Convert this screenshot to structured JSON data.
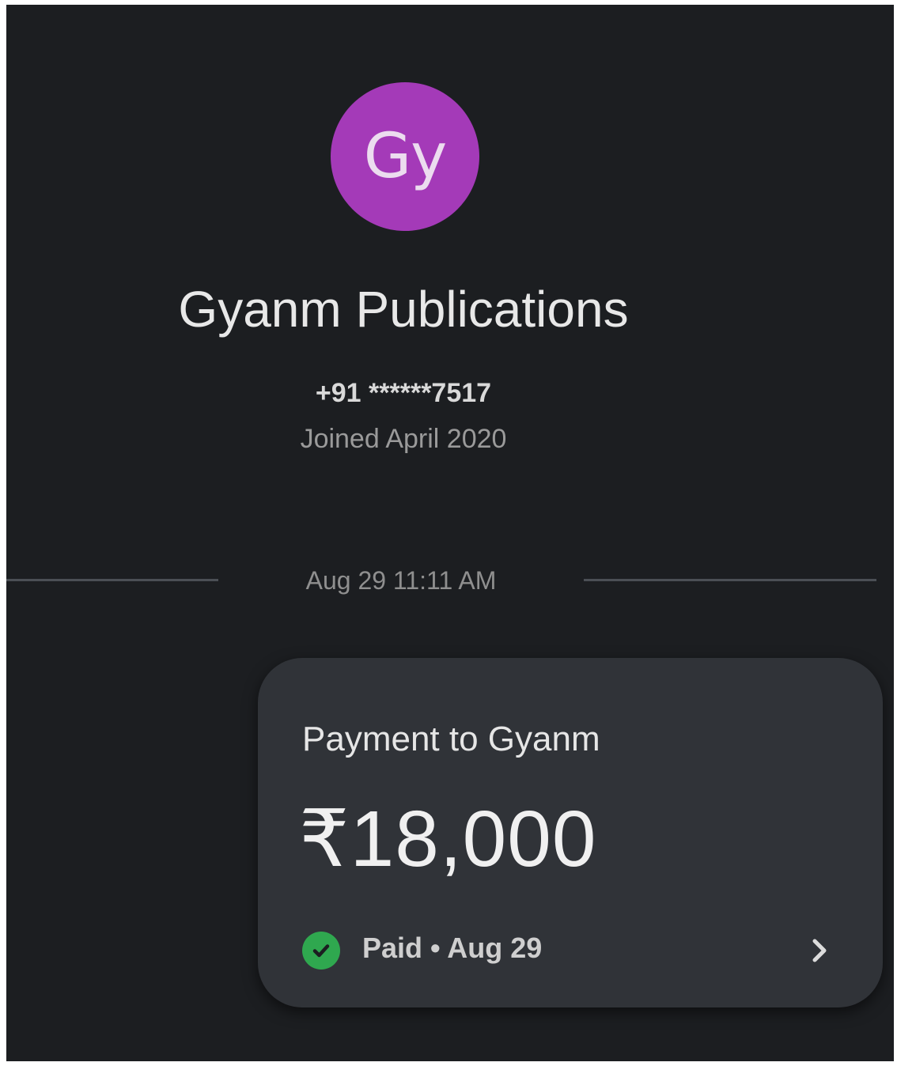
{
  "contact": {
    "avatar_initials": "Gy",
    "avatar_color": "#a43ab8",
    "name": "Gyanm Publications",
    "phone": "+91 ******7517",
    "joined": "Joined April 2020"
  },
  "timeline": {
    "date_separator": "Aug 29 11:11 AM"
  },
  "payment_card": {
    "title": "Payment to Gyanm",
    "amount": "₹18,000",
    "status_text": "Paid • Aug 29",
    "status_icon": "check-circle-icon",
    "status_color": "#2fa84f",
    "chevron_icon": "chevron-right-icon"
  }
}
